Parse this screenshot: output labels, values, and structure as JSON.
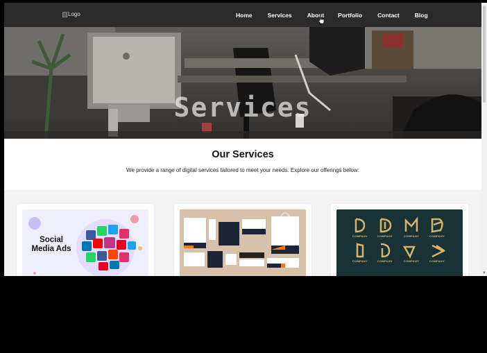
{
  "nav": {
    "logo_alt": "Logo",
    "items": [
      {
        "label": "Home"
      },
      {
        "label": "Services"
      },
      {
        "label": "About"
      },
      {
        "label": "Portfolio"
      },
      {
        "label": "Contact"
      },
      {
        "label": "Blog"
      }
    ]
  },
  "hero": {
    "title": "Services"
  },
  "services": {
    "heading": "Our Services",
    "subtitle": "We provide a range of digital services tailored to meet your needs. Explore our offerings below:",
    "cards": [
      {
        "image_text_line1": "Social",
        "image_text_line2": "Media Ads",
        "image_icon": "social-media-cubes"
      },
      {
        "image_icon": "branding-stationery"
      },
      {
        "image_icon": "logo-collection",
        "logo_caption": "COMPANY"
      }
    ]
  },
  "colors": {
    "nav_bg": "#2b2b2b",
    "section_bg": "#f3f3f3",
    "card1_bg": "#efeefc",
    "card2_bg": "#d7c1aa",
    "card3_bg": "#183236",
    "logo_gold": "#d8b46a"
  }
}
